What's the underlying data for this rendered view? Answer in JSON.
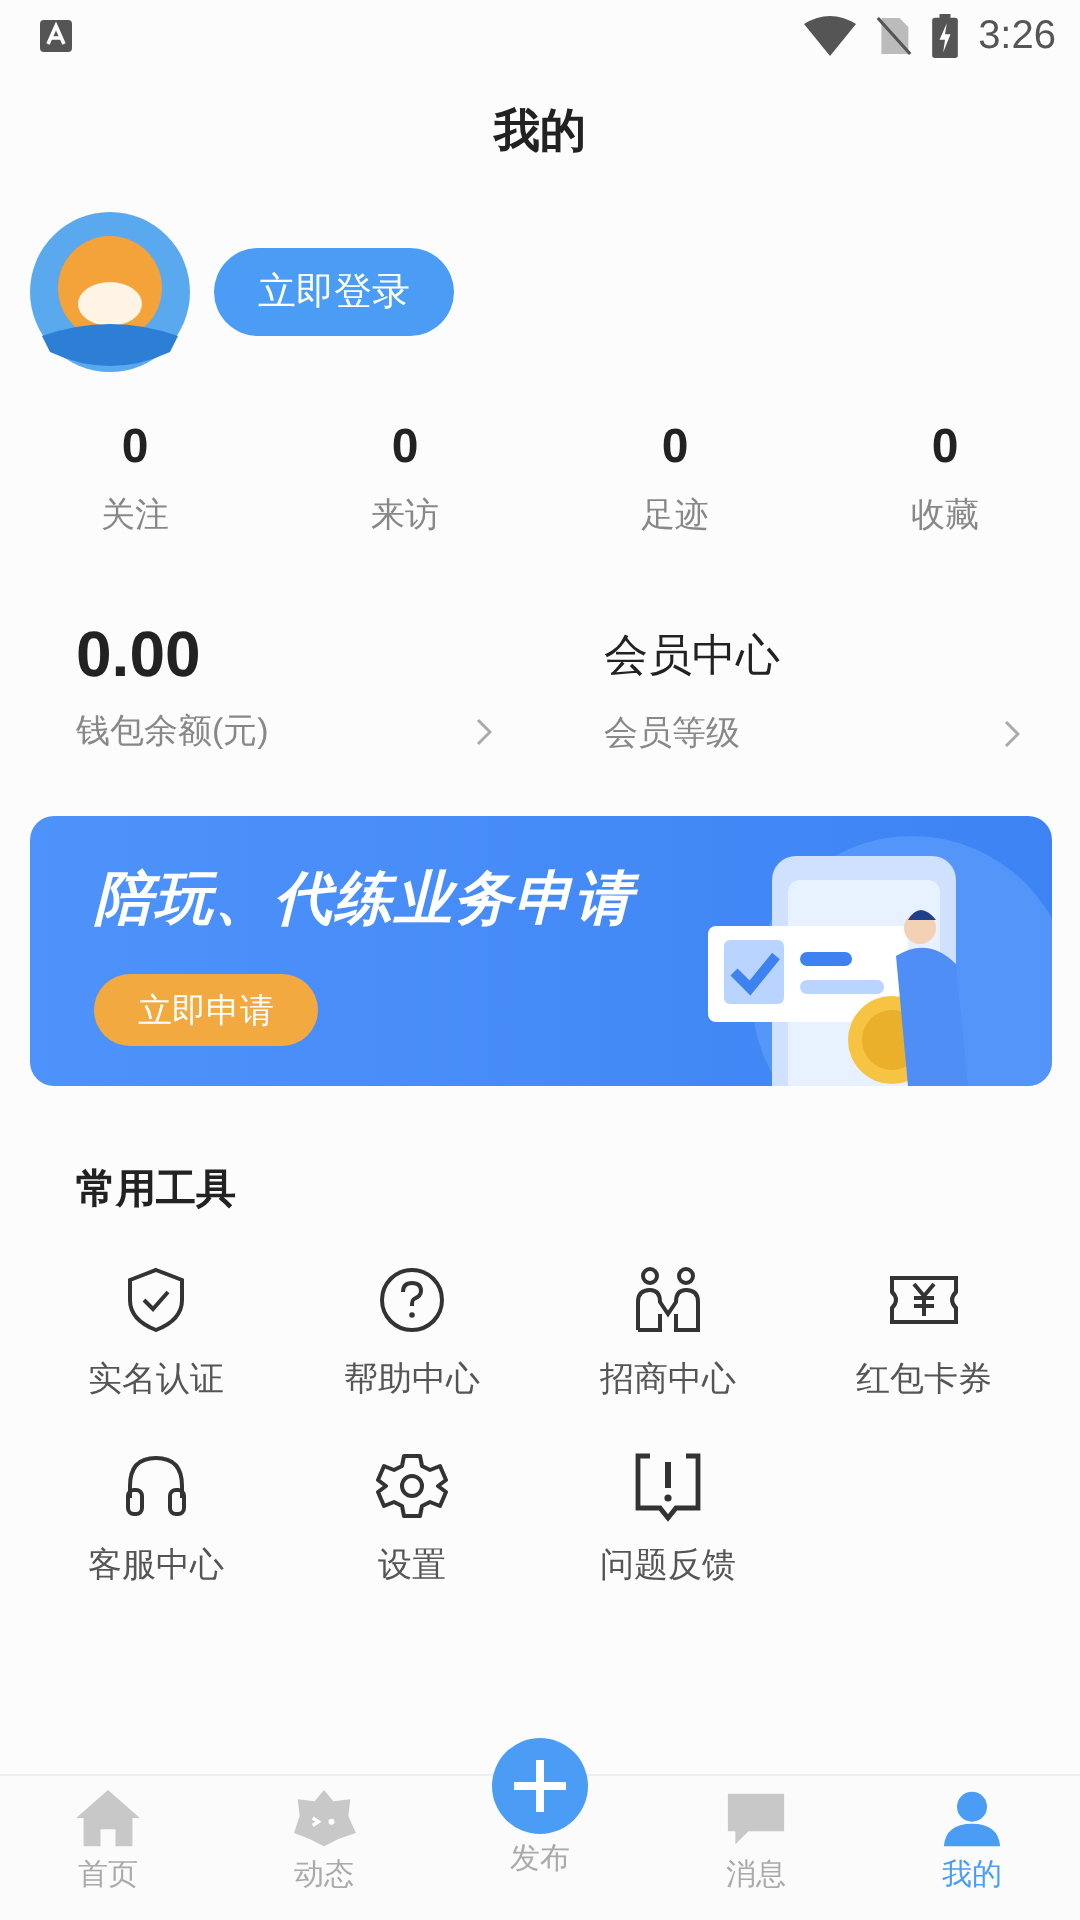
{
  "status_bar": {
    "time": "3:26"
  },
  "title": "我的",
  "profile": {
    "login_button": "立即登录"
  },
  "stats": [
    {
      "value": "0",
      "label": "关注"
    },
    {
      "value": "0",
      "label": "来访"
    },
    {
      "value": "0",
      "label": "足迹"
    },
    {
      "value": "0",
      "label": "收藏"
    }
  ],
  "wallet": {
    "amount": "0.00",
    "label": "钱包余额(元)"
  },
  "membership": {
    "title": "会员中心",
    "label": "会员等级"
  },
  "banner": {
    "title": "陪玩、代练业务申请",
    "button": "立即申请"
  },
  "tools": {
    "title": "常用工具",
    "items": [
      {
        "label": "实名认证",
        "kind": "shield"
      },
      {
        "label": "帮助中心",
        "kind": "help"
      },
      {
        "label": "招商中心",
        "kind": "partners"
      },
      {
        "label": "红包卡券",
        "kind": "coupon"
      },
      {
        "label": "客服中心",
        "kind": "headset"
      },
      {
        "label": "设置",
        "kind": "settings"
      },
      {
        "label": "问题反馈",
        "kind": "feedback"
      }
    ]
  },
  "bottom_nav": [
    {
      "label": "首页",
      "kind": "home",
      "selected": false
    },
    {
      "label": "动态",
      "kind": "feed",
      "selected": false
    },
    {
      "label": "发布",
      "kind": "publish",
      "selected": false
    },
    {
      "label": "消息",
      "kind": "message",
      "selected": false
    },
    {
      "label": "我的",
      "kind": "profile",
      "selected": true
    }
  ]
}
